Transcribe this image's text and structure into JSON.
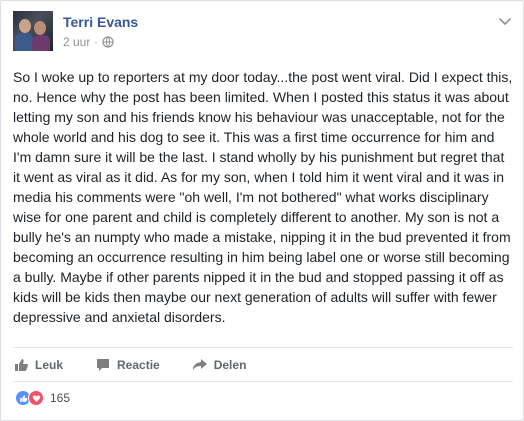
{
  "post": {
    "author": "Terri Evans",
    "time": "2 uur",
    "separator": "·",
    "privacy_icon": "globe-icon",
    "menu_icon": "chevron-down-icon",
    "text": "So I woke up to reporters at my door today...the post went viral. Did I expect this, no. Hence why the post has been limited. When I posted this status it was about letting my son and his friends know his behaviour was unacceptable, not for the whole world and his dog to see it. This was a first time occurrence for him and I'm damn sure it will be the last. I stand wholly by his punishment but regret that it went as viral as it did. As for my son, when I told him it went viral and it was in media his comments were \"oh well, I'm not bothered\" what works disciplinary wise for one parent and child is completely different to another. My son is not a bully he's an numpty who made a mistake, nipping it in the bud prevented it from becoming an occurrence resulting in him being label one or worse still becoming a bully. Maybe if other parents nipped it in the bud and stopped passing it off as kids will be kids then maybe our next generation of adults will suffer with fewer depressive and anxietal disorders."
  },
  "actions": {
    "like": "Leuk",
    "comment": "Reactie",
    "share": "Delen"
  },
  "reactions": {
    "count": "165",
    "icons": [
      "like-icon",
      "love-icon"
    ]
  },
  "colors": {
    "link": "#365899",
    "muted": "#90949c",
    "action": "#616770",
    "like": "#5890ff",
    "love": "#f25268"
  }
}
